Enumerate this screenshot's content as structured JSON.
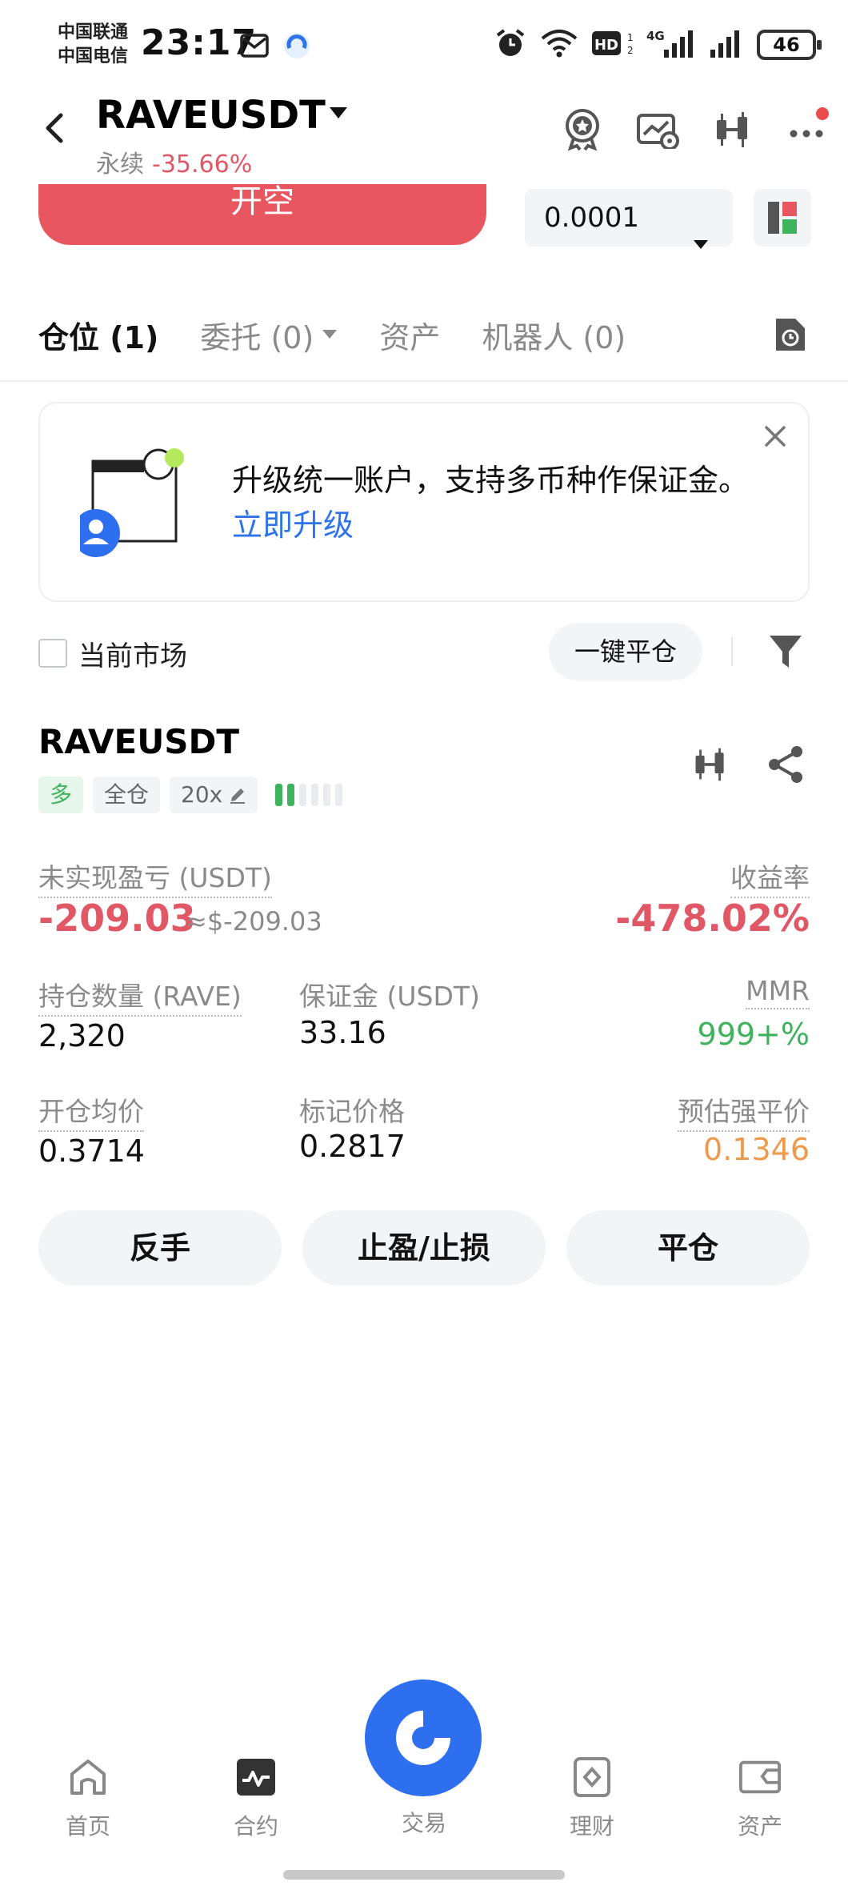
{
  "status_bar": {
    "carrier1": "中国联通",
    "carrier2": "中国电信",
    "time": "23:17",
    "battery": "46"
  },
  "header": {
    "symbol": "RAVEUSDT",
    "perp_label": "永续",
    "change": "-35.66%"
  },
  "order": {
    "short_label": "开空",
    "quantity_step": "0.0001"
  },
  "tabs": {
    "positions": "仓位 (1)",
    "orders": "委托 (0)",
    "assets": "资产",
    "bots": "机器人 (0)"
  },
  "banner": {
    "text": "升级统一账户，支持多币种作保证金。",
    "link": "立即升级"
  },
  "filter": {
    "current_market": "当前市场",
    "close_all": "一键平仓"
  },
  "position": {
    "symbol": "RAVEUSDT",
    "side": "多",
    "margin_mode": "全仓",
    "leverage": "20x",
    "risk_level": 2,
    "unrealized_pnl_label": "未实现盈亏 (USDT)",
    "unrealized_pnl": "-209.03",
    "unrealized_pnl_usd": "≈$-209.03",
    "roe_label": "收益率",
    "roe": "-478.02%",
    "size_label": "持仓数量 (RAVE)",
    "size": "2,320",
    "margin_label": "保证金 (USDT)",
    "margin": "33.16",
    "mmr_label": "MMR",
    "mmr": "999+%",
    "entry_label": "开仓均价",
    "entry": "0.3714",
    "mark_label": "标记价格",
    "mark": "0.2817",
    "liq_label": "预估强平价",
    "liq": "0.1346"
  },
  "actions": {
    "reverse": "反手",
    "tpsl": "止盈/止损",
    "close": "平仓"
  },
  "bottom_nav": {
    "home": "首页",
    "futures": "合约",
    "trade": "交易",
    "earn": "理财",
    "assets": "资产"
  },
  "colors": {
    "red": "#e05866",
    "green": "#3fb25e",
    "orange": "#ee9a4d",
    "blue": "#2e6ff0"
  }
}
